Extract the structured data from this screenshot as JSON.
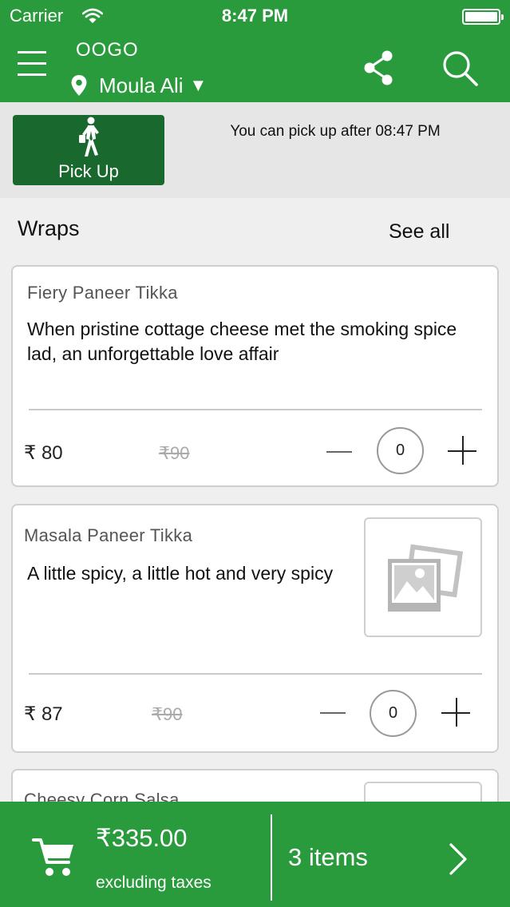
{
  "status_bar": {
    "carrier": "Carrier",
    "time": "8:47 PM"
  },
  "header": {
    "app_name": "OOGO",
    "location": "Moula Ali",
    "location_caret": "▼",
    "icons": [
      "menu-icon",
      "location-pin-icon",
      "share-icon",
      "search-icon"
    ]
  },
  "pickup": {
    "button_label": "Pick Up",
    "button_icon": "walking-person-icon",
    "info": "You can pick up after 08:47 PM"
  },
  "section": {
    "title": "Wraps",
    "see_all": "See all"
  },
  "items": [
    {
      "name": "Fiery Paneer Tikka",
      "description": "When pristine cottage cheese met the smoking spice lad, an unforgettable love affair",
      "price": "₹ 80",
      "old_price": "₹90",
      "quantity": "0"
    },
    {
      "name": "Masala Paneer Tikka",
      "description": "A little spicy, a little hot and very spicy",
      "price": "₹ 87",
      "old_price": "₹90",
      "quantity": "0",
      "image": "image-placeholder-icon"
    },
    {
      "name": "Cheesy Corn Salsa"
    }
  ],
  "cart": {
    "total": "₹335.00",
    "taxes_note": "excluding taxes",
    "items_count": "3 items"
  },
  "colors": {
    "brand_green": "#2a9b3c",
    "pickup_green": "#19692f",
    "background": "#efefef"
  }
}
